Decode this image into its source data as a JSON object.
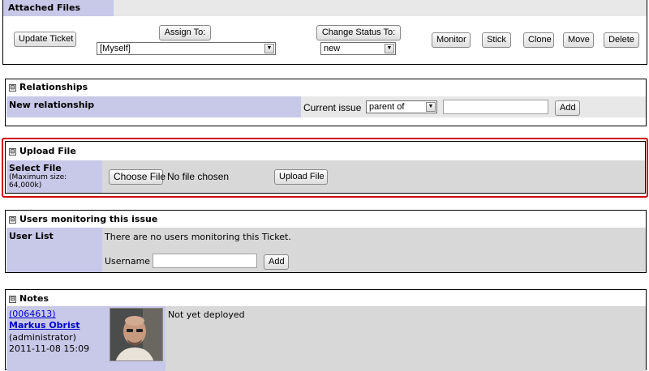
{
  "attached_files": {
    "title": "Attached Files",
    "update_button": "Update Ticket",
    "assign_to_button": "Assign To:",
    "assign_to_value": "[Myself]",
    "change_status_button": "Change Status To:",
    "status_value": "new",
    "monitor_button": "Monitor",
    "stick_button": "Stick",
    "clone_button": "Clone",
    "move_button": "Move",
    "delete_button": "Delete"
  },
  "relationships": {
    "toggle": "⊟",
    "title": "Relationships",
    "new_label": "New relationship",
    "current_issue_label": "Current issue",
    "relation_value": "parent of",
    "add_button": "Add"
  },
  "upload": {
    "toggle": "⊟",
    "title": "Upload File",
    "select_label": "Select File",
    "max_size_line1": "(Maximum size:",
    "max_size_line2": "64,000k)",
    "choose_button": "Choose File",
    "no_file_text": "No file chosen",
    "upload_button": "Upload File",
    "highlight_color": "#d00000"
  },
  "monitoring": {
    "toggle": "⊟",
    "title": "Users monitoring this issue",
    "user_list_label": "User List",
    "no_users_text": "There are no users monitoring this Ticket.",
    "username_label": "Username",
    "add_button": "Add"
  },
  "notes": {
    "toggle": "⊟",
    "title": "Notes",
    "note_id": "(0064613)",
    "author": "Markus Obrist",
    "role": "(administrator)",
    "timestamp": "2011-11-08 15:09",
    "text": "Not yet deployed"
  }
}
